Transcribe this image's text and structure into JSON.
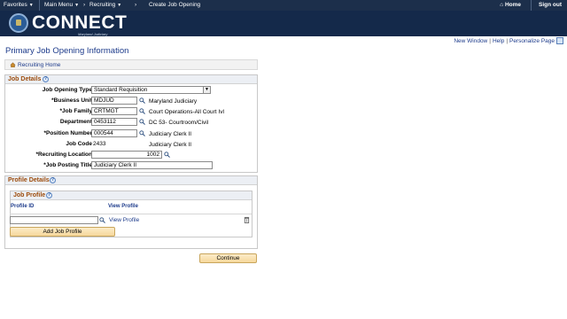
{
  "topnav": {
    "favorites": "Favorites",
    "main_menu": "Main Menu",
    "recruiting": "Recruiting",
    "create_job_opening": "Create Job Opening",
    "home": "Home",
    "sign_out": "Sign out"
  },
  "banner": {
    "logo": "CONNECT",
    "sub": "Maryland Judiciary"
  },
  "header_links": {
    "new_window": "New Window",
    "help": "Help",
    "personalize": "Personalize Page"
  },
  "page": {
    "title": "Primary Job Opening Information",
    "recruiting_home": "Recruiting Home"
  },
  "job_details": {
    "title": "Job Details",
    "job_opening_type_label": "Job Opening Type",
    "job_opening_type_value": "Standard Requisition",
    "business_unit_label": "*Business Unit",
    "business_unit_value": "MDJUD",
    "business_unit_desc": "Maryland Judiciary",
    "job_family_label": "*Job Family",
    "job_family_value": "CRTMGT",
    "job_family_desc": "Court Operations-All Court Ivl",
    "department_label": "Department",
    "department_value": "0453112",
    "department_desc": "DC 53- Courtroom/Civil",
    "position_number_label": "*Position Number",
    "position_number_value": "000544",
    "position_number_desc": "Judiciary Clerk II",
    "job_code_label": "Job Code",
    "job_code_value": "2433",
    "job_code_desc": "Judiciary Clerk II",
    "recruiting_location_label": "*Recruiting Location",
    "recruiting_location_value": "1002",
    "job_posting_title_label": "*Job Posting Title",
    "job_posting_title_value": "Judiciary Clerk II"
  },
  "profile_details": {
    "title": "Profile Details",
    "job_profile_title": "Job Profile",
    "col_profile_id": "Profile ID",
    "col_view_profile": "View Profile",
    "row_view_profile": "View Profile",
    "add_job_profile": "Add Job Profile"
  },
  "continue": "Continue",
  "colors": {
    "nav": "#1c2f4b",
    "banner": "#14294a",
    "link": "#1d3b8b",
    "section_title": "#9c4b0b",
    "button": "#f6d89c"
  }
}
